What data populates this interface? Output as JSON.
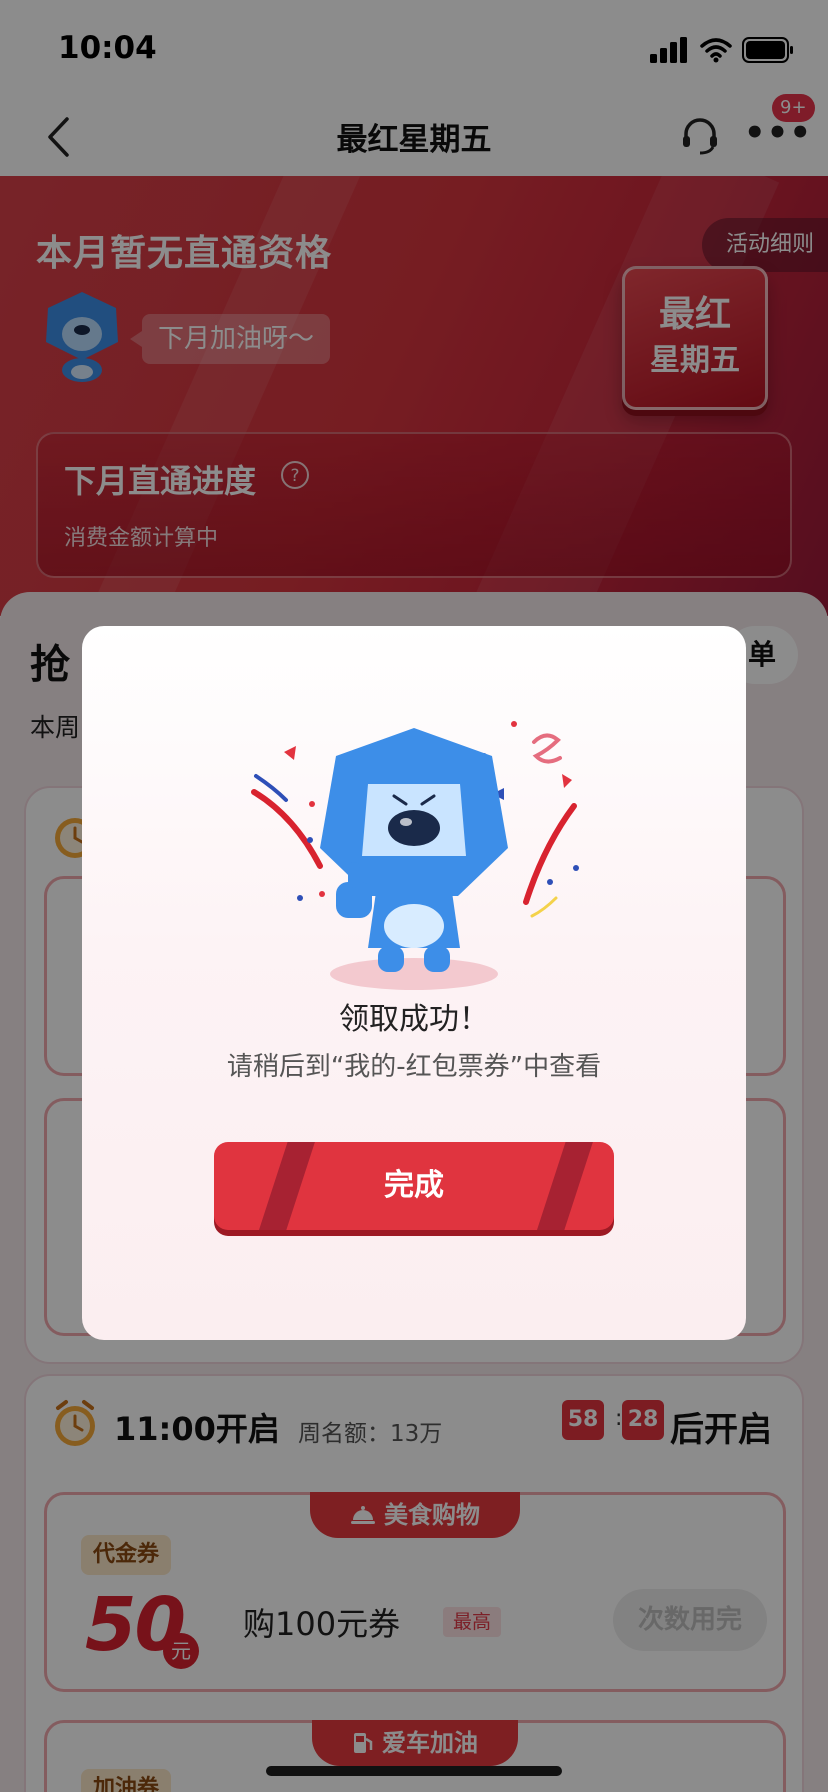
{
  "status_bar": {
    "time": "10:04"
  },
  "nav": {
    "title": "最红星期五",
    "badge": "9+"
  },
  "hero": {
    "title": "本月暂无直通资格",
    "rules": "活动细则",
    "bubble": "下月加油呀～",
    "logo_line1": "最红",
    "logo_line2": "星期五",
    "progress_title": "下月直通进度",
    "progress_sub": "消费金额计算中"
  },
  "content": {
    "grab_title_visible": "抢",
    "list_btn_visible": "单",
    "week_text_visible": "本周"
  },
  "section_b": {
    "time": "11:00开启",
    "quota": "周名额：13万",
    "countdown_min": "58",
    "countdown_sec": "28",
    "countdown_suffix": "后开启",
    "coupon1": {
      "tag": "美食购物",
      "type": "代金券",
      "amount": "50",
      "unit": "元",
      "desc": "购100元券",
      "max": "最高",
      "button": "次数用完"
    },
    "coupon2": {
      "tag": "爱车加油",
      "type": "加油券"
    }
  },
  "modal": {
    "title": "领取成功！",
    "subtitle": "请稍后到“我的-红包票券”中查看",
    "button": "完成"
  },
  "colors": {
    "brand_red": "#e2333f",
    "hero_red": "#d8363f",
    "badge_red": "#e8334b",
    "mascot_blue": "#3d8ee8"
  },
  "icons": {
    "back": "chevron-left-icon",
    "service": "headset-icon",
    "more": "more-dots-icon",
    "help": "question-circle-icon",
    "clock": "alarm-clock-icon"
  }
}
